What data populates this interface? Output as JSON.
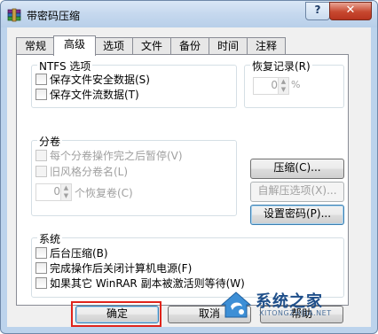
{
  "window": {
    "title": "带密码压缩",
    "help_glyph": "?",
    "close_glyph": "✕"
  },
  "tabs": [
    {
      "label": "常规",
      "active": false
    },
    {
      "label": "高级",
      "active": true
    },
    {
      "label": "选项",
      "active": false
    },
    {
      "label": "文件",
      "active": false
    },
    {
      "label": "备份",
      "active": false
    },
    {
      "label": "时间",
      "active": false
    },
    {
      "label": "注释",
      "active": false
    }
  ],
  "ntfs": {
    "legend": "NTFS 选项",
    "items": [
      {
        "label": "保存文件安全数据(S)",
        "checked": false,
        "enabled": true
      },
      {
        "label": "保存文件流数据(T)",
        "checked": false,
        "enabled": true
      }
    ]
  },
  "recovery": {
    "legend": "恢复记录(R)",
    "value": "0",
    "unit": "%"
  },
  "volumes": {
    "legend": "分卷",
    "items": [
      {
        "label": "每个分卷操作完之后暂停(V)",
        "checked": false,
        "enabled": false
      },
      {
        "label": "旧风格分卷名(L)",
        "checked": false,
        "enabled": false
      }
    ],
    "recovery_volumes_value": "0",
    "recovery_volumes_label": "个恢复卷(C)"
  },
  "side_buttons": {
    "compress": "压缩(C)...",
    "sfx_options": "自解压选项(X)...",
    "set_password": "设置密码(P)..."
  },
  "system": {
    "legend": "系统",
    "items": [
      {
        "label": "后台压缩(B)",
        "checked": false
      },
      {
        "label": "完成操作后关闭计算机电源(F)",
        "checked": false
      },
      {
        "label": "如果其它 WinRAR 副本被激活则等待(W)",
        "checked": false
      }
    ]
  },
  "footer": {
    "ok": "确定",
    "cancel": "取消",
    "help": "帮助"
  },
  "watermark": {
    "brand": "系统之家",
    "url": "XITONGZHIJIA.NET"
  },
  "colors": {
    "highlight_box": "#e0241b",
    "title_gradient_top": "#d9e7f6",
    "close_button": "#c7482f"
  }
}
